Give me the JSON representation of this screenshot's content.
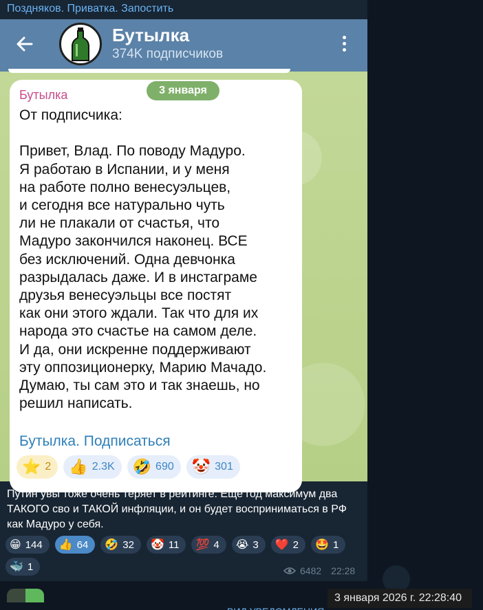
{
  "post": {
    "header": "Поздняков. Приватка. Запостить",
    "caption": "Путин увы тоже очень теряет в рейтинге. Еще год максимум два ТАКОГО сво и ТАКОЙ инфляции, и он будет восприниматься в РФ как Мадуро у себя.",
    "reactions": [
      {
        "icon": "grinning-face",
        "emoji": "😁",
        "count": "144",
        "active": false
      },
      {
        "icon": "thumbs-up",
        "emoji": "👍",
        "count": "64",
        "active": true
      },
      {
        "icon": "rofl-face",
        "emoji": "🤣",
        "count": "32",
        "active": false
      },
      {
        "icon": "clown-face",
        "emoji": "🤡",
        "count": "11",
        "active": false
      },
      {
        "icon": "hundred-points",
        "emoji": "💯",
        "count": "4",
        "active": false
      },
      {
        "icon": "crying-face",
        "emoji": "😭",
        "count": "3",
        "active": false
      },
      {
        "icon": "red-heart",
        "emoji": "❤️",
        "count": "2",
        "active": false
      },
      {
        "icon": "star-struck",
        "emoji": "🤩",
        "count": "1",
        "active": false
      },
      {
        "icon": "whale",
        "emoji": "🐳",
        "count": "1",
        "active": false
      }
    ],
    "views": "6482",
    "time": "22:28"
  },
  "screenshot": {
    "channel_title": "Бутылка",
    "channel_subscribers": "374K подписчиков",
    "date_pill": "3 января",
    "author": "Бутылка",
    "text": "От подписчика:\n\nПривет, Влад. По поводу Мадуро.\nЯ работаю в Испании, и у меня\nна работе полно венесуэльцев,\nи сегодня все натурально чуть\nли не плакали от счастья, что\nМадуро закончился наконец. ВСЕ\nбез исключений. Одна девчонка\nразрыдалась даже. И в инстаграме\nдрузья венесуэльцы все постят\nкак они этого ждали. Так что для их\nнарода это счастье на самом деле.\nИ да, они искренне поддерживают\nэту оппозиционерку, Марию Мачадо.\nДумаю, ты сам это и так знаешь, но\nрешил написать.",
    "link": "Бутылка. Подписаться",
    "reactions": [
      {
        "icon": "star",
        "emoji": "⭐",
        "count": "2"
      },
      {
        "icon": "thumbs-up",
        "emoji": "👍",
        "count": "2.3K"
      },
      {
        "icon": "rofl-face",
        "emoji": "🤣",
        "count": "690"
      },
      {
        "icon": "clown-face",
        "emoji": "🤡",
        "count": "301"
      }
    ]
  },
  "overlay": {
    "timestamp": "3 января 2026 г. 22:28:40",
    "cutoff_text": "ВИД УВЕДОМЛЕНИЯ"
  },
  "colors": {
    "link": "#6ab3f3",
    "active_reaction": "#4b89c7",
    "author": "#c94b8b"
  }
}
